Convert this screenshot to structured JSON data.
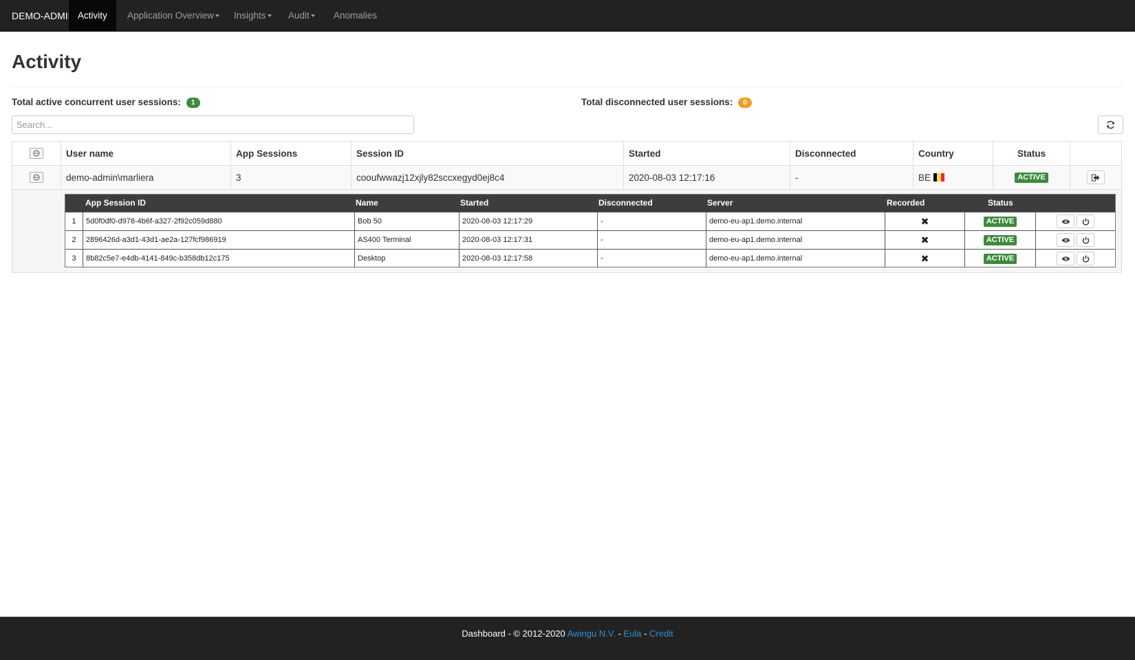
{
  "navbar": {
    "brand": "DEMO-ADMIN",
    "items": [
      {
        "label": "Activity",
        "active": true,
        "dropdown": false
      },
      {
        "label": "Application Overview",
        "active": false,
        "dropdown": true
      },
      {
        "label": "Insights",
        "active": false,
        "dropdown": true
      },
      {
        "label": "Audit",
        "active": false,
        "dropdown": true
      },
      {
        "label": "Anomalies",
        "active": false,
        "dropdown": false
      }
    ]
  },
  "page": {
    "title": "Activity",
    "active_sessions_label": "Total active concurrent user sessions:",
    "active_sessions_count": "1",
    "disconnected_sessions_label": "Total disconnected user sessions:",
    "disconnected_sessions_count": "0",
    "search_placeholder": "Search...",
    "search_value": ""
  },
  "sessions_table": {
    "headers": [
      "User name",
      "App Sessions",
      "Session ID",
      "Started",
      "Disconnected",
      "Country",
      "Status"
    ],
    "row": {
      "user_name": "demo-admin\\marliera",
      "app_sessions": "3",
      "session_id": "cooufwwazj12xjly82sccxegyd0ej8c4",
      "started": "2020-08-03 12:17:16",
      "disconnected": "-",
      "country": "BE",
      "country_flag_colors": [
        "#000000",
        "#FAE042",
        "#ED2939"
      ],
      "status": "ACTIVE"
    }
  },
  "app_sessions_table": {
    "headers": [
      "App Session ID",
      "Name",
      "Started",
      "Disconnected",
      "Server",
      "Recorded",
      "Status"
    ],
    "rows": [
      {
        "num": "1",
        "id": "5d0f0df0-d978-4b6f-a327-2f92c059d880",
        "name": "Bob 50",
        "started": "2020-08-03 12:17:29",
        "disconnected": "-",
        "server": "demo-eu-ap1.demo.internal",
        "recorded": "no",
        "status": "ACTIVE"
      },
      {
        "num": "2",
        "id": "2896426d-a3d1-43d1-ae2a-127fcf986919",
        "name": "AS400 Terminal",
        "started": "2020-08-03 12:17:31",
        "disconnected": "-",
        "server": "demo-eu-ap1.demo.internal",
        "recorded": "no",
        "status": "ACTIVE"
      },
      {
        "num": "3",
        "id": "8b82c5e7-e4db-4141-849c-b358db12c175",
        "name": "Desktop",
        "started": "2020-08-03 12:17:58",
        "disconnected": "-",
        "server": "demo-eu-ap1.demo.internal",
        "recorded": "no",
        "status": "ACTIVE"
      }
    ]
  },
  "footer": {
    "prefix": "Dashboard - © 2012-2020",
    "company_link": "Awingu N.V.",
    "sep1": "-",
    "eula_link": "Eula",
    "sep2": "-",
    "credit_link": "Credit"
  },
  "colors": {
    "navbar_bg": "#222222",
    "active_badge": "#3c8b3c",
    "disconnected_badge": "#f0a020",
    "link": "#2f8fd8"
  }
}
